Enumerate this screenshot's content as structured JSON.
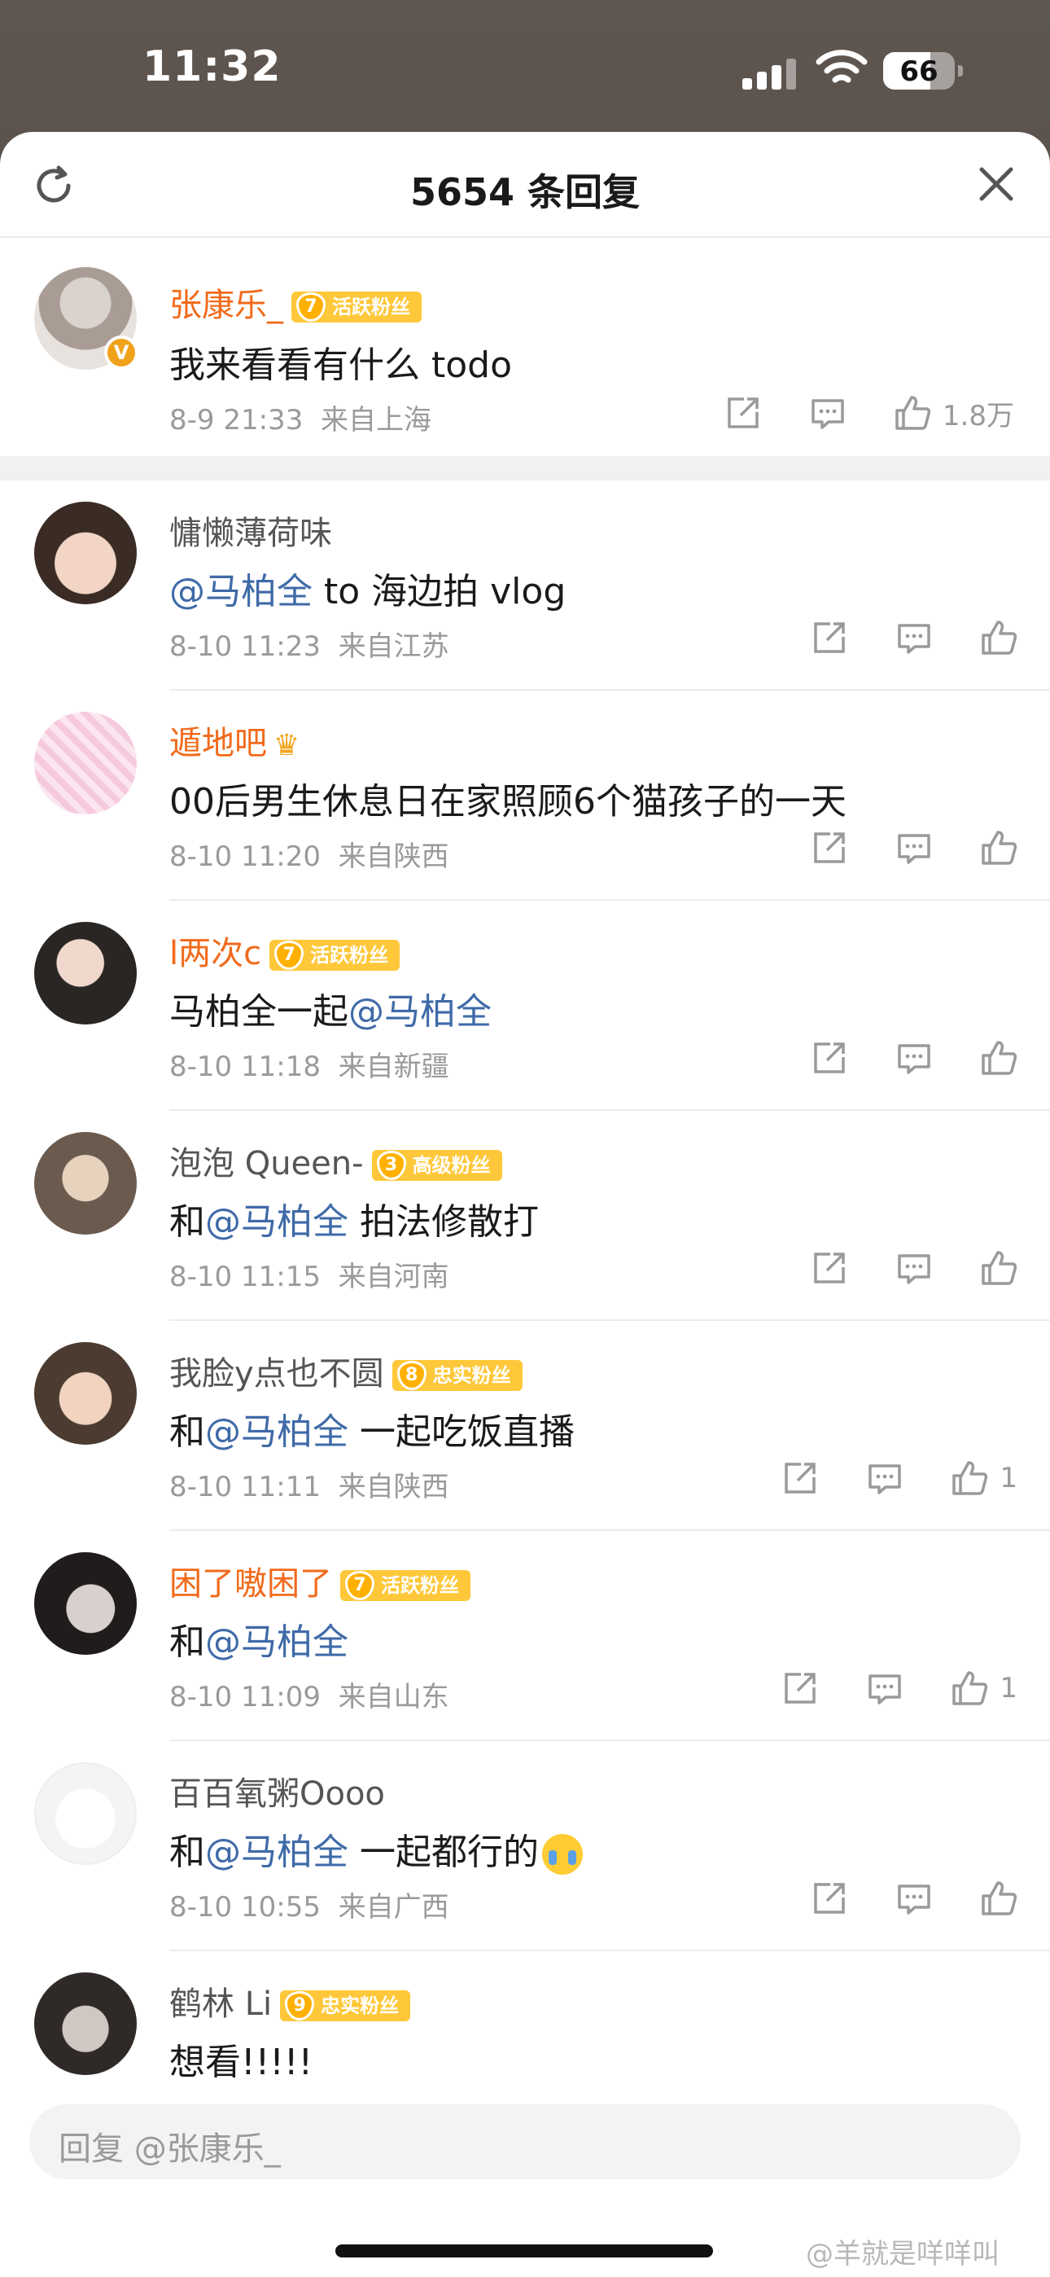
{
  "status_bar": {
    "time": "11:32",
    "battery": "66"
  },
  "header": {
    "title": "5654 条回复"
  },
  "comments": [
    {
      "name": "张康乐_",
      "badge_level": "7",
      "badge_text": "活跃粉丝",
      "text_parts": [
        "我来看看有什么 todo"
      ],
      "time": "8-9 21:33",
      "location": "来自上海",
      "likes": "1.8万"
    },
    {
      "name": "慵懒薄荷味",
      "text_mention": "@马柏全",
      "text_after": " to 海边拍 vlog",
      "time": "8-10 11:23",
      "location": "来自江苏"
    },
    {
      "name": "遁地吧",
      "text": "00后男生休息日在家照顾6个猫孩子的一天",
      "time": "8-10 11:20",
      "location": "来自陕西"
    },
    {
      "name": "l两次c",
      "badge_level": "7",
      "badge_text": "活跃粉丝",
      "text_before": "马柏全一起",
      "text_mention": "@马柏全",
      "time": "8-10 11:18",
      "location": "来自新疆"
    },
    {
      "name": "泡泡 Queen-",
      "badge_level": "3",
      "badge_text": "高级粉丝",
      "text_before": "和",
      "text_mention": "@马柏全",
      "text_after": " 拍法修散打",
      "time": "8-10 11:15",
      "location": "来自河南"
    },
    {
      "name": "我脸y点也不圆",
      "badge_level": "8",
      "badge_text": "忠实粉丝",
      "text_before": "和",
      "text_mention": "@马柏全",
      "text_after": " 一起吃饭直播",
      "time": "8-10 11:11",
      "location": "来自陕西",
      "likes": "1"
    },
    {
      "name": "困了嗷困了",
      "badge_level": "7",
      "badge_text": "活跃粉丝",
      "text_before": "和",
      "text_mention": "@马柏全",
      "time": "8-10 11:09",
      "location": "来自山东",
      "likes": "1"
    },
    {
      "name": "百百氧粥Oooo",
      "text_before": "和",
      "text_mention": "@马柏全",
      "text_after": " 一起都行的",
      "time": "8-10 10:55",
      "location": "来自广西"
    },
    {
      "name": "鹤林 Li",
      "badge_level": "9",
      "badge_text": "忠实粉丝",
      "text": "想看!!!!!"
    }
  ],
  "reply_placeholder": "回复 @张康乐_",
  "watermark": "@羊就是咩咩叫",
  "colors": {
    "accent_orange": "#f26a1b",
    "mention_blue": "#3f6aa8",
    "badge_yellow": "#ffc83a"
  }
}
